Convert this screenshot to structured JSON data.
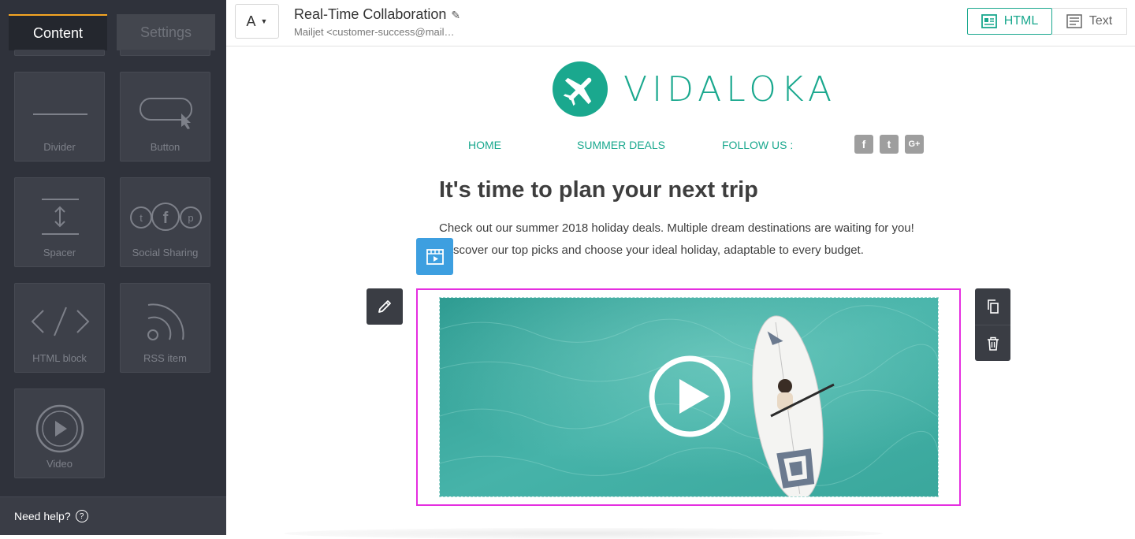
{
  "sidebar": {
    "tabs": {
      "content": "Content",
      "settings": "Settings"
    },
    "blocks": {
      "divider": "Divider",
      "button": "Button",
      "spacer": "Spacer",
      "social": "Social Sharing",
      "html": "HTML block",
      "rss": "RSS item",
      "video": "Video"
    },
    "help": "Need help?",
    "help_icon": "?"
  },
  "toolbar": {
    "font_label": "A",
    "caret": "▼",
    "title": "Real-Time Collaboration",
    "edit_icon": "✎",
    "sender": "Mailjet <customer-success@mail…",
    "view_html": "HTML",
    "view_text": "Text"
  },
  "email": {
    "brand": "VIDALOKA",
    "nav": {
      "home": "HOME",
      "deals": "SUMMER DEALS",
      "follow": "FOLLOW US :"
    },
    "social": {
      "facebook": "f",
      "twitter": "t",
      "google": "G+"
    },
    "heading": "It's time to plan your next trip",
    "para1": "Check out our summer 2018 holiday deals. Multiple dream destinations are waiting for you!",
    "para2": "scover our top picks and choose your ideal holiday, adaptable to every budget."
  },
  "colors": {
    "accent": "#1aa88e",
    "selection": "#e52ee0",
    "block_type": "#3d9fe0",
    "sidebar": "#2f323b"
  }
}
